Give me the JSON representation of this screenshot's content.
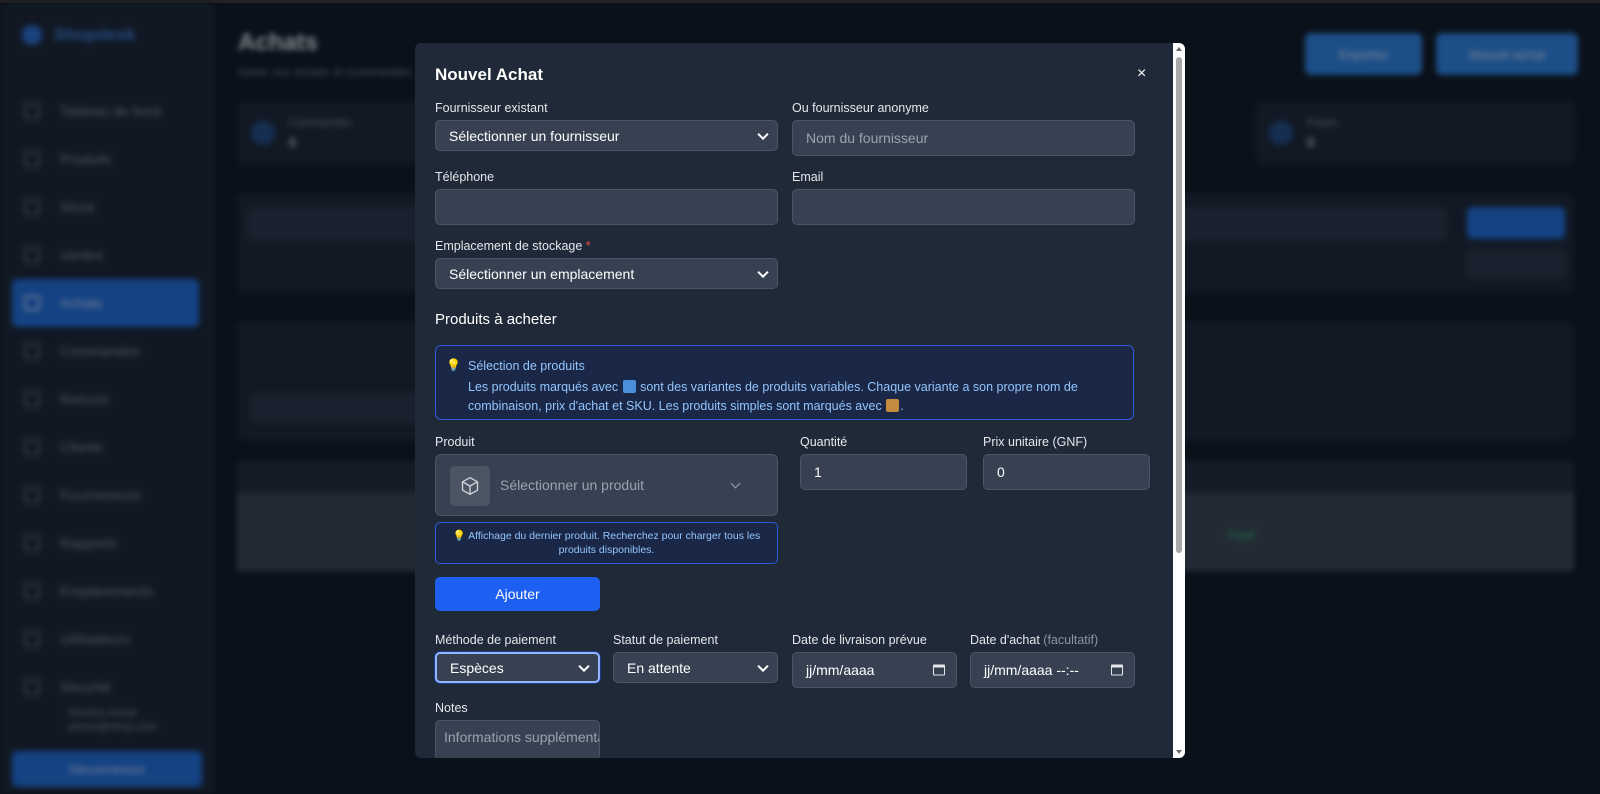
{
  "background": {
    "brand": "Shopdesk",
    "page_title": "Achats",
    "page_subtitle": "Gérer vos achats et commandes",
    "nav_items": [
      {
        "label": "Tableau de bord"
      },
      {
        "label": "Produits"
      },
      {
        "label": "Stock"
      },
      {
        "label": "Ventes"
      },
      {
        "label": "Achats"
      },
      {
        "label": "Commandes"
      },
      {
        "label": "Retours"
      },
      {
        "label": "Clients"
      },
      {
        "label": "Fournisseurs"
      },
      {
        "label": "Rapports"
      },
      {
        "label": "Emplacements"
      },
      {
        "label": "Utilisateurs"
      },
      {
        "label": "Sécurité"
      }
    ],
    "user_line1": "Gestion Achat",
    "user_line2": "admin@shop.com",
    "logout_label": "Déconnexion",
    "header_btn1": "Exporter",
    "header_btn2": "Nouvel achat",
    "stat1_label": "Commandes",
    "stat1_value": "0",
    "stat2_label": "Payés",
    "stat2_value": "0",
    "status_badge": "Payé"
  },
  "modal": {
    "title": "Nouvel Achat",
    "close_glyph": "×",
    "supplier": {
      "label": "Fournisseur existant",
      "value": "Sélectionner un fournisseur"
    },
    "anonymous_supplier": {
      "label": "Ou fournisseur anonyme",
      "placeholder": "Nom du fournisseur"
    },
    "phone": {
      "label": "Téléphone",
      "value": ""
    },
    "email": {
      "label": "Email",
      "value": ""
    },
    "storage": {
      "label": "Emplacement de stockage",
      "required_mark": "*",
      "value": "Sélectionner un emplacement"
    },
    "products_section_title": "Produits à acheter",
    "info": {
      "icon": "lightbulb-icon",
      "bulb_glyph": "💡",
      "title": "Sélection de produits",
      "text_part1": "Les produits marqués avec",
      "text_part2": "sont des variantes de produits variables. Chaque variante a son propre nom de combinaison, prix d'achat et SKU. Les produits simples sont marqués avec",
      "text_part3": "."
    },
    "product": {
      "label": "Produit",
      "placeholder": "Sélectionner un produit",
      "icon": "package-icon"
    },
    "quantity": {
      "label": "Quantité",
      "value": "1"
    },
    "unit_price": {
      "label": "Prix unitaire (GNF)",
      "value": "0"
    },
    "hint": "💡 Affichage du dernier produit. Recherchez pour charger tous les produits disponibles.",
    "add_button": "Ajouter",
    "payment_method": {
      "label": "Méthode de paiement",
      "value": "Espèces"
    },
    "payment_status": {
      "label": "Statut de paiement",
      "value": "En attente"
    },
    "delivery_date": {
      "label": "Date de livraison prévue",
      "value": "jj/mm/aaaa"
    },
    "purchase_date": {
      "label": "Date d'achat",
      "optional": "(facultatif)",
      "value": "jj/mm/aaaa --:--"
    },
    "notes": {
      "label": "Notes",
      "placeholder": "Informations supplémentaires"
    }
  },
  "colors": {
    "primary": "#1d5ff0",
    "modal_bg": "#1f2937",
    "input_bg": "#374151",
    "info_border": "#2f5bd6",
    "info_text": "#93c5fd",
    "required": "#ef4444"
  }
}
